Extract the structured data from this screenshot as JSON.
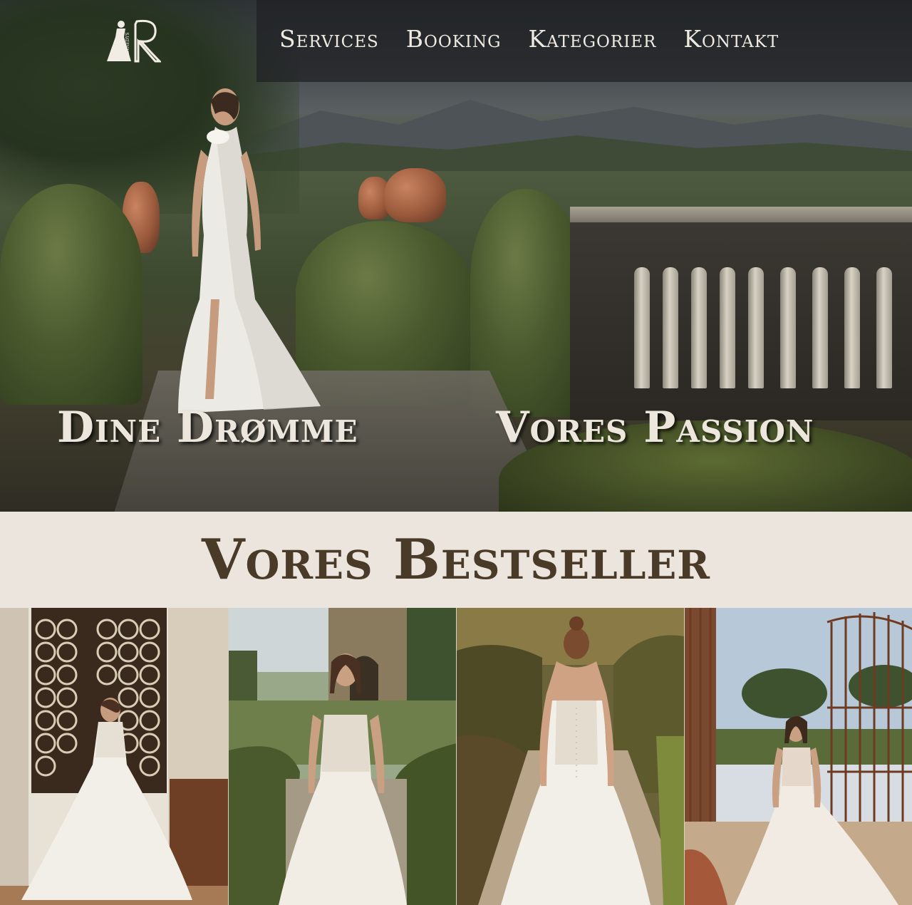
{
  "brand": {
    "logo_alt": "Kennedy's",
    "logo_lettering": "KENNEDYS"
  },
  "nav": {
    "items": [
      {
        "label": "Services"
      },
      {
        "label": "Booking"
      },
      {
        "label": "Kategorier"
      },
      {
        "label": "Kontakt"
      }
    ]
  },
  "hero": {
    "caption_left": "Dine Drømme",
    "caption_right": "Vores Passion"
  },
  "bestseller": {
    "title": "Vores Bestseller",
    "products": [
      {
        "icon": "bride-dress-image"
      },
      {
        "icon": "bride-dress-image"
      },
      {
        "icon": "bride-dress-image"
      },
      {
        "icon": "bride-dress-image"
      }
    ]
  },
  "colors": {
    "nav_text": "#efeae1",
    "hero_caption": "#ece6dc",
    "band_bg": "#ebe5de",
    "band_title": "#4a3a28"
  }
}
